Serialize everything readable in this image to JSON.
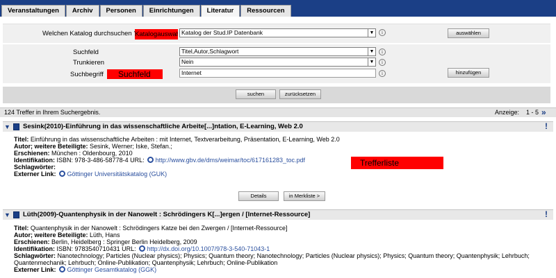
{
  "nav": {
    "tabs": [
      {
        "label": "Veranstaltungen",
        "active": false
      },
      {
        "label": "Archiv",
        "active": false
      },
      {
        "label": "Personen",
        "active": false
      },
      {
        "label": "Einrichtungen",
        "active": false
      },
      {
        "label": "Literatur",
        "active": true
      },
      {
        "label": "Ressourcen",
        "active": false
      }
    ]
  },
  "form": {
    "catalog_question": "Welchen Katalog durchsuchen ?",
    "catalog_annotation": "Katalogauswahl",
    "catalog_selected": "Katalog der Stud.IP Datenbank",
    "select_button": "auswählen",
    "field_label": "Suchfeld",
    "field_selected": "Titel,Autor,Schlagwort",
    "truncate_label": "Trunkieren",
    "truncate_selected": "Nein",
    "term_label": "Suchbegriff",
    "term_annotation": "Suchfeld",
    "term_value": "Internet",
    "add_button": "hinzufügen",
    "search_button": "suchen",
    "reset_button": "zurücksetzen"
  },
  "results": {
    "hits_text": "124 Treffer in Ihrem Suchergebnis.",
    "display_label": "Anzeige:",
    "page_range": "1 - 5",
    "annotation": "Trefferliste",
    "entries": [
      {
        "heading": "Sesink(2010)-Einführung in das wissenschaftliche Arbeite[...]ntation, E-Learning, Web 2.0",
        "title_label": "Titel:",
        "title": "Einführung in das wissenschaftliche Arbeiten : mit Internet, Textverarbeitung, Präsentation, E-Learning, Web 2.0",
        "author_label": "Autor; weitere Beteiligte:",
        "author": "Sesink, Werner; Iske, Stefan.;",
        "published_label": "Erschienen:",
        "published": "München : Oldenbourg, 2010",
        "ident_label": "Identifikation:",
        "ident": "ISBN: 978-3-486-58778-4 URL:",
        "url": "http://www.gbv.de/dms/weimar/toc/617161283_toc.pdf",
        "keywords_label": "Schlagwörter:",
        "keywords": "",
        "extlink_label": "Externer Link:",
        "extlink": "Göttinger Universitätskatalog (GUK)",
        "details_button": "Details",
        "merkliste_button": "in Merkliste >"
      },
      {
        "heading": "Lüth(2009)-Quantenphysik in der Nanowelt : Schrödingers K[...]ergen / [Internet-Ressource]",
        "title_label": "Titel:",
        "title": "Quantenphysik in der Nanowelt : Schrödingers Katze bei den Zwergen / [Internet-Ressource]",
        "author_label": "Autor; weitere Beteiligte:",
        "author": "Lüth, Hans",
        "published_label": "Erschienen:",
        "published": "Berlin, Heidelberg : Springer Berlin Heidelberg, 2009",
        "ident_label": "Identifikation:",
        "ident": "ISBN: 9783540710431 URL:",
        "url": "http://dx.doi.org/10.1007/978-3-540-71043-1",
        "keywords_label": "Schlagwörter:",
        "keywords_line1": "Nanotechnology; Particles (Nuclear physics); Physics; Quantum theory; Nanotechnology; Particles (Nuclear physics); Physics; Quantum theory; Quantenphysik; Lehrbuch;",
        "keywords_line2": "Quantenmechanik; Lehrbuch; Online-Publikation; Quantenphysik; Lehrbuch; Online-Publikation",
        "extlink_label": "Externer Link:",
        "extlink": "Göttinger Gesamtkatalog (GGK)"
      }
    ]
  }
}
